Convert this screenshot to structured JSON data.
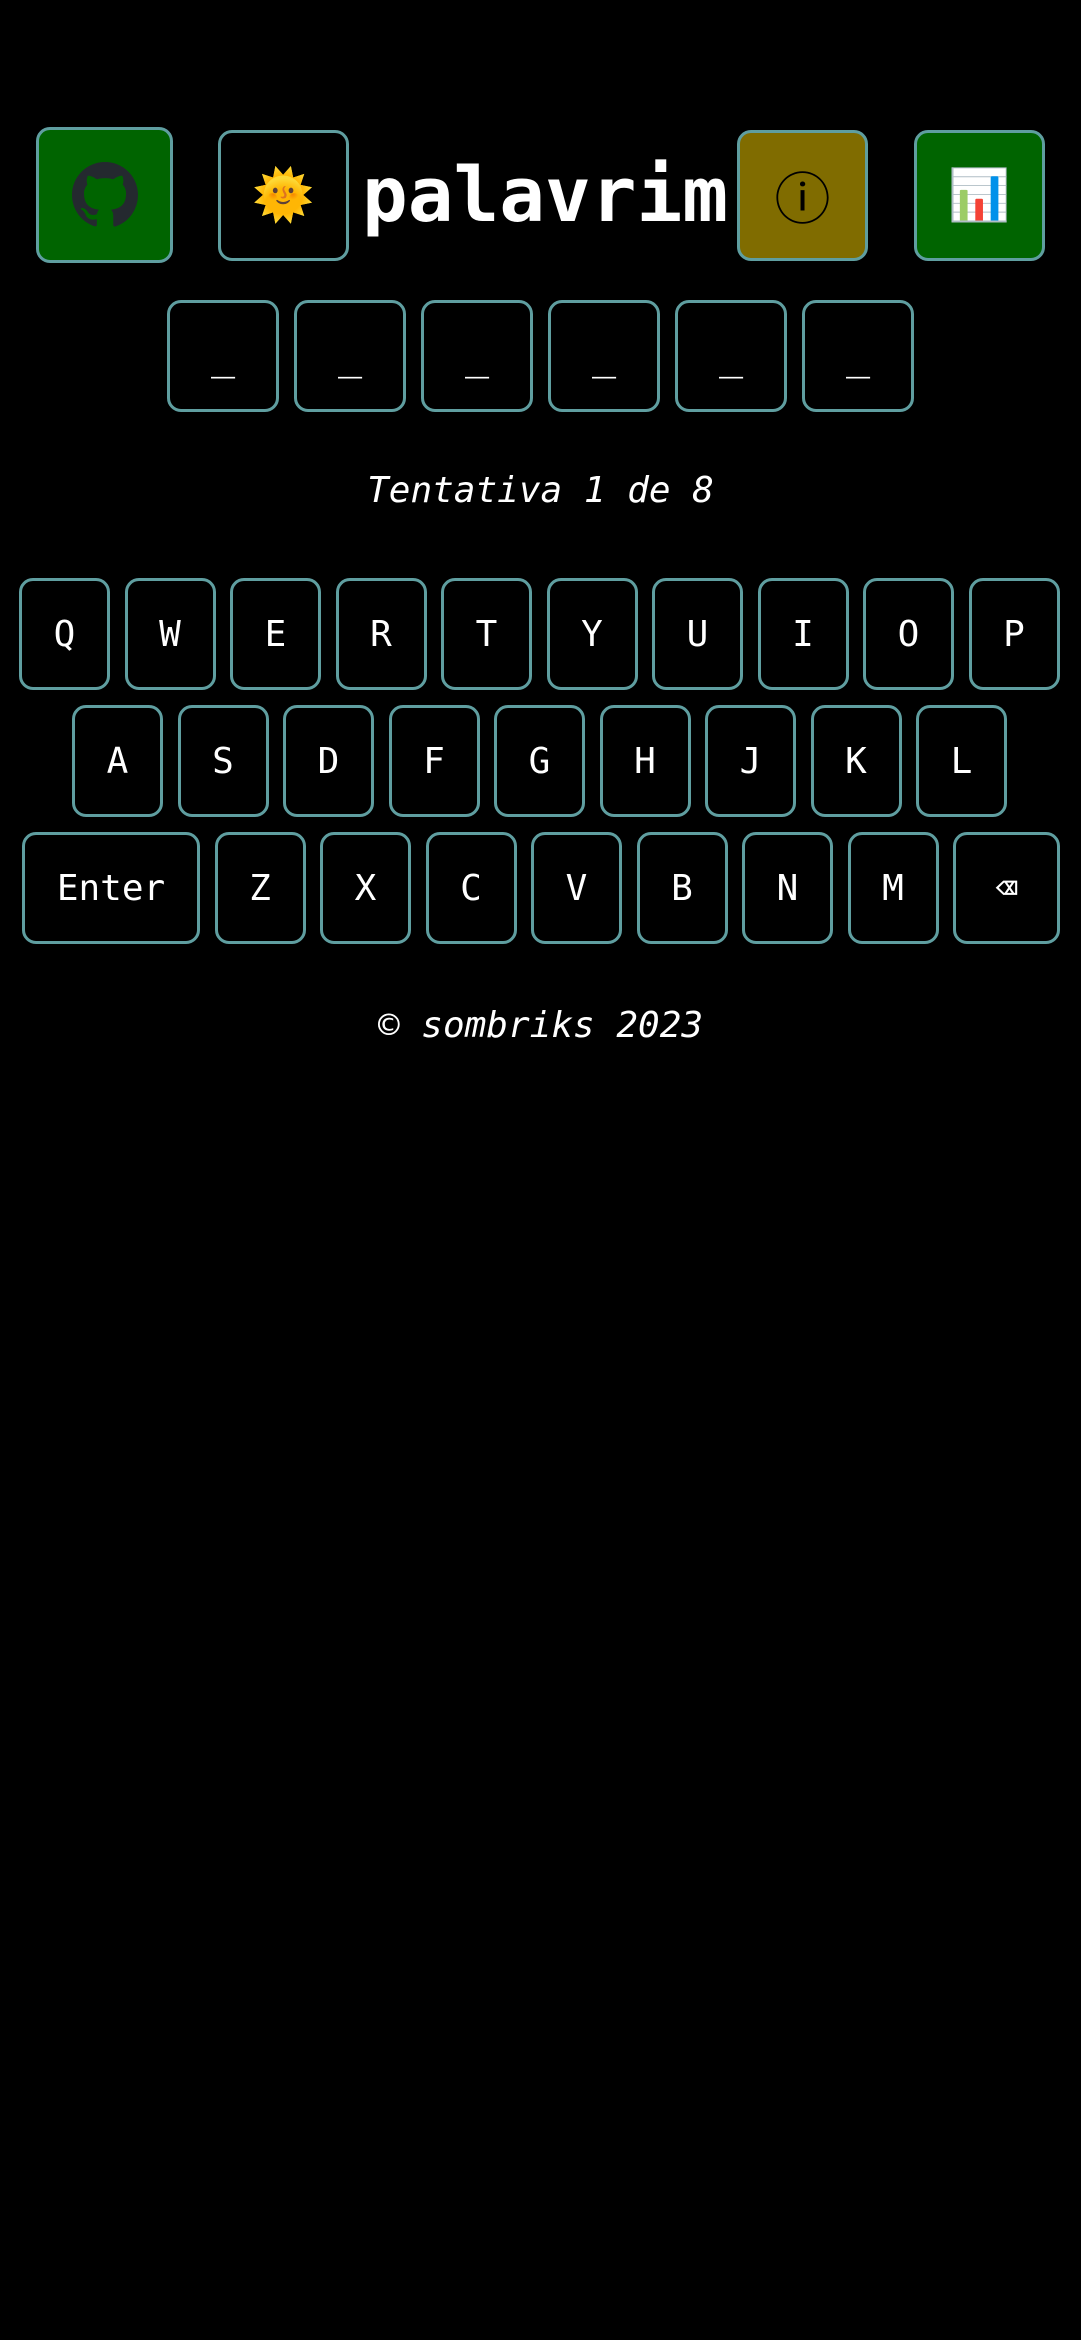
{
  "header": {
    "title": "palavrim",
    "github_icon": "github-icon",
    "theme_icon": "🌞",
    "info_icon": "ⓘ",
    "stats_icon": "📊",
    "colors": {
      "github_bg": "#006400",
      "info_bg": "#806c00",
      "stats_bg": "#006400",
      "border": "#5f9ea0"
    }
  },
  "tiles": [
    "_",
    "_",
    "_",
    "_",
    "_",
    "_"
  ],
  "status": "Tentativa 1 de 8",
  "keyboard": {
    "row1": [
      "Q",
      "W",
      "E",
      "R",
      "T",
      "Y",
      "U",
      "I",
      "O",
      "P"
    ],
    "row2": [
      "A",
      "S",
      "D",
      "F",
      "G",
      "H",
      "J",
      "K",
      "L"
    ],
    "row3": [
      "Enter",
      "Z",
      "X",
      "C",
      "V",
      "B",
      "N",
      "M",
      "⌫"
    ]
  },
  "footer": "© sombriks 2023"
}
